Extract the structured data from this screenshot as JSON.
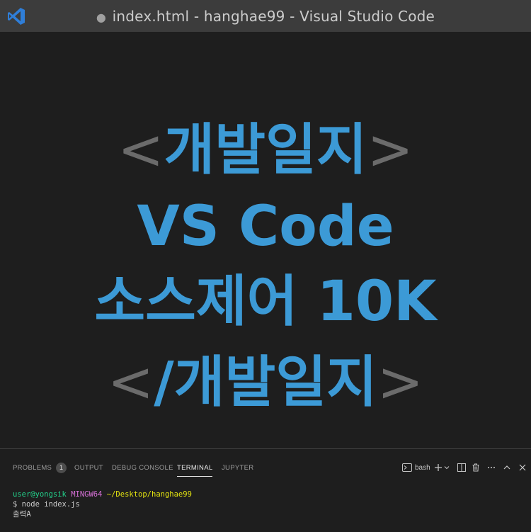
{
  "window": {
    "title": "index.html - hanghae99 - Visual Studio Code",
    "unsaved_dot": "●",
    "app_icon": "vscode-logo-icon"
  },
  "editor": {
    "line1": {
      "open": "<",
      "text": "개발일지",
      "close": ">"
    },
    "line2": {
      "text": "VS Code"
    },
    "line3": {
      "text": "소스제어 10K"
    },
    "line4": {
      "open": "<",
      "text": "/개발일지",
      "close": ">"
    }
  },
  "panel": {
    "tabs": [
      {
        "label": "PROBLEMS",
        "badge": "1"
      },
      {
        "label": "OUTPUT"
      },
      {
        "label": "DEBUG CONSOLE"
      },
      {
        "label": "TERMINAL",
        "active": true
      },
      {
        "label": "JUPYTER"
      }
    ],
    "toolbar": {
      "shell_label": "bash",
      "icons": [
        "terminal-icon",
        "plus-icon",
        "chevron-down-icon",
        "split-icon",
        "trash-icon",
        "more-icon",
        "chevron-up-icon",
        "close-icon"
      ]
    },
    "terminal": {
      "user": "user@yongsik",
      "system": "MINGW64",
      "path": "~/Desktop/hanghae99",
      "command": "$ node index.js",
      "output": "출력A"
    }
  },
  "colors": {
    "accent_blue": "#3c9ad6",
    "bracket_gray": "#6b6b6b",
    "titlebar": "#3c3c3c",
    "background": "#1e1e1e"
  }
}
